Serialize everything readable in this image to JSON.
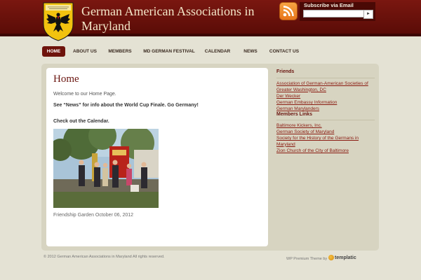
{
  "header": {
    "site_title": "German American Associations in Maryland",
    "subscribe_label": "Subscribe via Email",
    "subscribe_button_label": "►"
  },
  "nav": {
    "items": [
      {
        "label": "HOME",
        "active": true
      },
      {
        "label": "ABOUT US"
      },
      {
        "label": "MEMBERS"
      },
      {
        "label": "MD GERMAN FESTIVAL"
      },
      {
        "label": "CALENDAR"
      },
      {
        "label": "NEWS"
      },
      {
        "label": "CONTACT US"
      }
    ]
  },
  "main": {
    "title": "Home",
    "welcome": "Welcome to our Home Page.",
    "news_line": "See “News” for info about the World Cup Finale. Go Germany!",
    "calendar_line": "Check out the Calendar.",
    "caption": "Friendship Garden October 06, 2012"
  },
  "sidebar": {
    "friends_heading": "Friends",
    "friends_links": [
      "Association of German-American Societies of Greater Washington, DC",
      "Der Wecker",
      "German Embassy Information",
      "German Marylanders"
    ],
    "members_heading": "Members Links",
    "members_links": [
      "Baltimore Kickers, Inc.",
      "German Society of Maryland",
      "Society for the History of the Germans in Maryland",
      "Zion Church of the City of Baltimore"
    ]
  },
  "footer": {
    "copyright": "© 2012 German American Associations in Maryland All rights reserved.",
    "theme_credit": "WP Premium Theme by",
    "templatic": "templatic"
  },
  "colors": {
    "header_red": "#6e130c",
    "link_red": "#8a1a10",
    "background": "#e4e2d4"
  }
}
